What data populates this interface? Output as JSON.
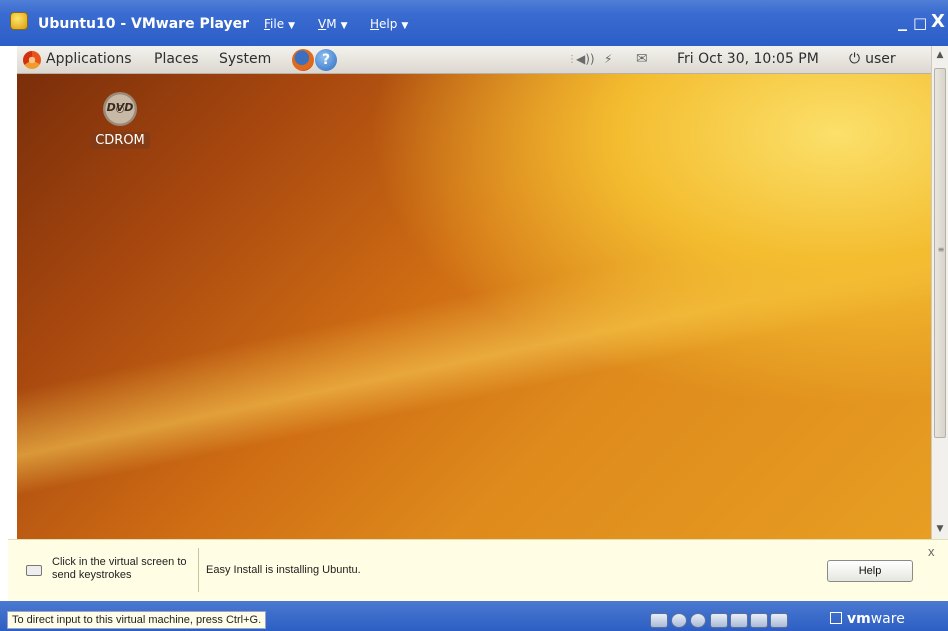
{
  "window": {
    "title": "Ubuntu10 - VMware Player",
    "menus": [
      {
        "label": "File",
        "accel": "F",
        "rest": "ile"
      },
      {
        "label": "VM",
        "accel": "V",
        "rest": "M"
      },
      {
        "label": "Help",
        "accel": "H",
        "rest": "elp"
      }
    ],
    "controls": {
      "minimize": "_",
      "maximize": "□",
      "close": "X"
    }
  },
  "guest_panel": {
    "menus": [
      "Applications",
      "Places",
      "System"
    ],
    "clock": "Fri Oct 30, 10:05 PM",
    "user": "user",
    "icons": {
      "logo": "ubuntu-logo-icon",
      "browser": "firefox-icon",
      "help": "help-icon",
      "volume": "volume-icon",
      "network": "network-icon",
      "mail": "mail-icon",
      "power": "power-icon"
    }
  },
  "desktop": {
    "icons": [
      {
        "label": "CDROM",
        "badge": "DVD"
      }
    ]
  },
  "infobar": {
    "hint": "Click in the virtual screen to send keystrokes",
    "status": "Easy Install is installing Ubuntu.",
    "help_button": "Help",
    "close": "x"
  },
  "statusbar": {
    "hint": "To direct input to this virtual machine, press Ctrl+G.",
    "brand_prefix": "vm",
    "brand_suffix": "ware"
  }
}
